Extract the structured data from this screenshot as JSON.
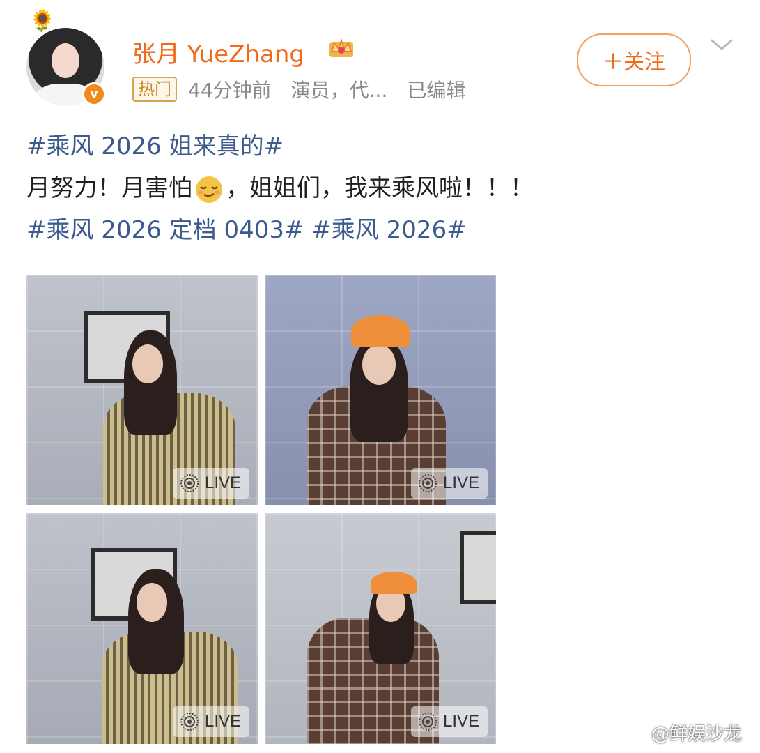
{
  "post": {
    "author": "张月 YueZhang",
    "hot_badge": "热门",
    "time": "44分钟前",
    "source": "演员，代...",
    "edited": "已编辑",
    "follow_label": "＋关注"
  },
  "content": {
    "line1_tag": "#乘风 2026 姐来真的#",
    "line2_before": "月努力！月害怕",
    "line2_after": "，姐姐们，我来乘风啦！！！",
    "line3_tag1": "#乘风 2026 定档 0403#",
    "line3_tag2": "#乘风 2026#"
  },
  "photos": [
    {
      "live_label": "LIVE"
    },
    {
      "live_label": "LIVE"
    },
    {
      "live_label": "LIVE"
    },
    {
      "live_label": "LIVE"
    }
  ],
  "watermark": "@鲜娱沙龙",
  "icons": {
    "sunflower": "sunflower-icon",
    "verified": "verified-badge-icon",
    "crown": "crown-icon",
    "chevron": "chevron-down-icon",
    "live": "live-photo-icon",
    "emoji": "relieved-face-emoji",
    "weibo": "weibo-logo-icon"
  },
  "colors": {
    "name": "#f06a1a",
    "topic": "#3c5a8c",
    "meta": "#8a8a8a",
    "follow_border": "#f0a060"
  }
}
